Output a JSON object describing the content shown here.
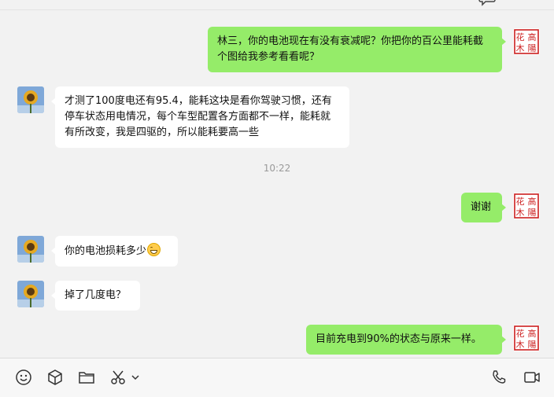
{
  "messages": [
    {
      "side": "right",
      "text": "林三，你的电池现在有没有衰减呢？你把你的百公里能耗截个图给我参考看看呢？"
    },
    {
      "side": "left",
      "text": "才测了100度电还有95.4，能耗这块是看你驾驶习惯，还有停车状态用电情况，每个车型配置各方面都不一样，能耗就有所改变，我是四驱的，所以能耗要高一些"
    },
    {
      "side": "right",
      "text": "谢谢"
    },
    {
      "side": "left",
      "text": "你的电池损耗多少",
      "emoji": "grinning-face-emoji"
    },
    {
      "side": "left",
      "text": "掉了几度电？"
    },
    {
      "side": "right",
      "text": "目前充电到90%的状态与原来一样。"
    }
  ],
  "timestamp": "10:22",
  "self_avatar": {
    "text_lines": [
      "花高",
      "木陽"
    ],
    "color": "#cc1f1f"
  },
  "contact_avatar": {
    "icon": "sunflower-avatar"
  },
  "toolbar": {
    "left_icons": [
      "emoji-icon",
      "package-icon",
      "folder-icon",
      "scissors-icon",
      "chevron-down-icon"
    ],
    "right_icons": [
      "phone-icon",
      "video-icon"
    ]
  },
  "colors": {
    "self_bubble": "#95ec69",
    "other_bubble": "#ffffff",
    "background": "#f2f2f2"
  }
}
